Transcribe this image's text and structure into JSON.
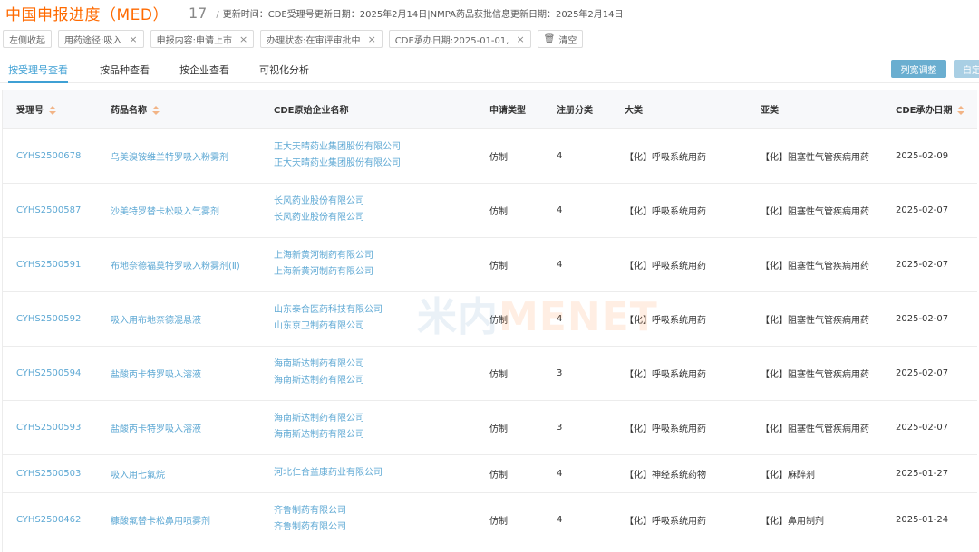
{
  "header": {
    "title": "中国申报进度（MED）",
    "count": "17",
    "update_text": "更新时间：CDE受理号更新日期：2025年2月14日|NMPA药品获批信息更新日期：2025年2月14日"
  },
  "filters": {
    "toggle_sidebar": "左侧收起",
    "chips": [
      "用药途径:吸入",
      "申报内容:申请上市",
      "办理状态:在审评审批中",
      "CDE承办日期:2025-01-01,"
    ],
    "clear": "清空"
  },
  "tabs": [
    "按受理号查看",
    "按品种查看",
    "按企业查看",
    "可视化分析"
  ],
  "buttons": {
    "column_adjust": "列宽调整",
    "custom": "自定"
  },
  "table": {
    "headers": {
      "accept_no": "受理号",
      "drug_name": "药品名称",
      "company": "CDE原始企业名称",
      "apply_type": "申请类型",
      "reg_class": "注册分类",
      "major_class": "大类",
      "sub_class": "亚类",
      "cde_date": "CDE承办日期"
    },
    "rows": [
      {
        "accept_no": "CYHS2500678",
        "drug_name": "乌美溴铵维兰特罗吸入粉雾剂",
        "company1": "正大天晴药业集团股份有限公司",
        "company2": "正大天晴药业集团股份有限公司",
        "apply_type": "仿制",
        "reg_class": "4",
        "major_class": "【化】呼吸系统用药",
        "sub_class": "【化】阻塞性气管疾病用药",
        "cde_date": "2025-02-09"
      },
      {
        "accept_no": "CYHS2500587",
        "drug_name": "沙美特罗替卡松吸入气雾剂",
        "company1": "长风药业股份有限公司",
        "company2": "长风药业股份有限公司",
        "apply_type": "仿制",
        "reg_class": "4",
        "major_class": "【化】呼吸系统用药",
        "sub_class": "【化】阻塞性气管疾病用药",
        "cde_date": "2025-02-07"
      },
      {
        "accept_no": "CYHS2500591",
        "drug_name": "布地奈德福莫特罗吸入粉雾剂(Ⅱ)",
        "company1": "上海新黄河制药有限公司",
        "company2": "上海新黄河制药有限公司",
        "apply_type": "仿制",
        "reg_class": "4",
        "major_class": "【化】呼吸系统用药",
        "sub_class": "【化】阻塞性气管疾病用药",
        "cde_date": "2025-02-07"
      },
      {
        "accept_no": "CYHS2500592",
        "drug_name": "吸入用布地奈德混悬液",
        "company1": "山东泰合医药科技有限公司",
        "company2": "山东京卫制药有限公司",
        "apply_type": "仿制",
        "reg_class": "4",
        "major_class": "【化】呼吸系统用药",
        "sub_class": "【化】阻塞性气管疾病用药",
        "cde_date": "2025-02-07"
      },
      {
        "accept_no": "CYHS2500594",
        "drug_name": "盐酸丙卡特罗吸入溶液",
        "company1": "海南斯达制药有限公司",
        "company2": "海南斯达制药有限公司",
        "apply_type": "仿制",
        "reg_class": "3",
        "major_class": "【化】呼吸系统用药",
        "sub_class": "【化】阻塞性气管疾病用药",
        "cde_date": "2025-02-07"
      },
      {
        "accept_no": "CYHS2500593",
        "drug_name": "盐酸丙卡特罗吸入溶液",
        "company1": "海南斯达制药有限公司",
        "company2": "海南斯达制药有限公司",
        "apply_type": "仿制",
        "reg_class": "3",
        "major_class": "【化】呼吸系统用药",
        "sub_class": "【化】阻塞性气管疾病用药",
        "cde_date": "2025-02-07"
      },
      {
        "accept_no": "CYHS2500503",
        "drug_name": "吸入用七氟烷",
        "company1": "河北仁合益康药业有限公司",
        "company2": "",
        "apply_type": "仿制",
        "reg_class": "4",
        "major_class": "【化】神经系统药物",
        "sub_class": "【化】麻醉剂",
        "cde_date": "2025-01-27"
      },
      {
        "accept_no": "CYHS2500462",
        "drug_name": "糠酸氟替卡松鼻用喷雾剂",
        "company1": "齐鲁制药有限公司",
        "company2": "齐鲁制药有限公司",
        "apply_type": "仿制",
        "reg_class": "4",
        "major_class": "【化】呼吸系统用药",
        "sub_class": "【化】鼻用制剂",
        "cde_date": "2025-01-24"
      }
    ]
  },
  "watermark": {
    "part1": "米内",
    "part2": "MENET"
  },
  "colors": {
    "accent": "#ff6a00",
    "link": "#5fa9d4",
    "tab_active": "#3fa0d4",
    "button": "#6aaed0"
  }
}
